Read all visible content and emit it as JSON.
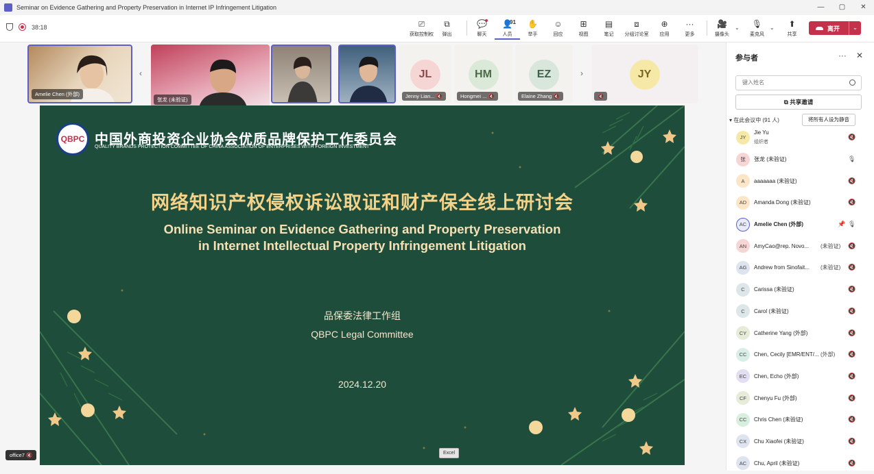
{
  "window": {
    "title": "Seminar on Evidence Gathering and Property Preservation in Internet IP Infringement Litigation",
    "controls": [
      "—",
      "▢",
      "✕"
    ]
  },
  "toolbar": {
    "timer": "38:18",
    "tools": [
      {
        "label": "获取控制权",
        "icon": "take-control-icon"
      },
      {
        "label": "弹出",
        "icon": "pop-out-icon"
      },
      {
        "label": "聊天",
        "icon": "chat-icon"
      },
      {
        "label": "人员",
        "icon": "people-icon",
        "count": "91"
      },
      {
        "label": "举手",
        "icon": "raise-hand-icon"
      },
      {
        "label": "回应",
        "icon": "react-icon"
      },
      {
        "label": "视图",
        "icon": "view-icon"
      },
      {
        "label": "笔记",
        "icon": "notes-icon"
      },
      {
        "label": "分组讨论室",
        "icon": "breakout-rooms-icon"
      },
      {
        "label": "应用",
        "icon": "apps-icon"
      },
      {
        "label": "更多",
        "icon": "more-icon"
      },
      {
        "label": "摄像头",
        "icon": "camera-off-icon"
      },
      {
        "label": "麦克风",
        "icon": "mic-off-icon"
      },
      {
        "label": "共享",
        "icon": "share-icon"
      }
    ],
    "leave_label": "离开"
  },
  "gallery": {
    "tiles": [
      {
        "name": "Amelie Chen (外部)"
      },
      {
        "name": "张龙 (未验证)"
      },
      {
        "name": ""
      },
      {
        "name": ""
      },
      {
        "name": "Jenny Lian...",
        "initials": "JL",
        "color": "#f6d5d5"
      },
      {
        "name": "Hongmei ...",
        "initials": "HM",
        "color": "#dbe9d8"
      },
      {
        "name": "Elaine Zhang",
        "initials": "EZ",
        "color": "#d8e6dc"
      },
      {
        "name": "",
        "initials": "JY",
        "color": "#f6e9a8"
      }
    ]
  },
  "slide": {
    "org_cn": "中国外商投资企业协会优质品牌保护工作委员会",
    "org_en": "QUALITY BRANDS PROTECTION COMMITTEE OF CHINA ASSOCIATION OF ENTERPRISES WITH FOREIGN INVESTMENT",
    "logo_text": "QBPC",
    "title_cn": "网络知识产权侵权诉讼取证和财产保全线上研讨会",
    "title_en_1": "Online Seminar on Evidence Gathering and Property Preservation",
    "title_en_2": "in Internet Intellectual Property Infringement Litigation",
    "group_cn": "品保委法律工作组",
    "group_en": "QBPC Legal Committee",
    "date": "2024.12.20"
  },
  "stage": {
    "excel_tag": "Excel",
    "office_tag": "office7"
  },
  "panel": {
    "title": "参与者",
    "search_placeholder": "键入姓名",
    "share_invite": "共享邀请",
    "in_meeting": "在此会议中 (91 人)",
    "mute_all": "将所有人设为静音",
    "participants": [
      {
        "initials": "JY",
        "name": "Jie Yu",
        "role": "组织者",
        "tag": "",
        "mic": "muted",
        "color": "#f6e9a8"
      },
      {
        "initials": "张",
        "name": "张龙 (未验证)",
        "role": "",
        "tag": "",
        "mic": "on",
        "color": "#f6d5d5"
      },
      {
        "initials": "A",
        "name": "aaaaaaa (未验证)",
        "role": "",
        "tag": "",
        "mic": "muted",
        "color": "#fbe6c8"
      },
      {
        "initials": "AD",
        "name": "Amanda Dong (未验证)",
        "role": "",
        "tag": "",
        "mic": "muted",
        "color": "#fbe6c8"
      },
      {
        "initials": "AC",
        "name": "Amelie Chen (外部)",
        "role": "",
        "tag": "",
        "mic": "on",
        "pin": true,
        "color": "#e8ebfa",
        "bold": true
      },
      {
        "initials": "AN",
        "name": "AmyCao@rep. Novo...",
        "role": "",
        "tag": "(未验证)",
        "mic": "muted",
        "color": "#f6d5d5"
      },
      {
        "initials": "AG",
        "name": "Andrew from Sinofait...",
        "role": "",
        "tag": "(未验证)",
        "mic": "muted",
        "color": "#dde3ef"
      },
      {
        "initials": "C",
        "name": "Carissa (未验证)",
        "role": "",
        "tag": "",
        "mic": "muted",
        "color": "#dde7ea"
      },
      {
        "initials": "C",
        "name": "Carol (未验证)",
        "role": "",
        "tag": "",
        "mic": "muted",
        "color": "#dde7ea"
      },
      {
        "initials": "CY",
        "name": "Catherine Yang (外部)",
        "role": "",
        "tag": "",
        "mic": "muted",
        "color": "#e6ecd8"
      },
      {
        "initials": "CC",
        "name": "Chen, Cecily [EMR/ENT/...",
        "role": "",
        "tag": "(外部)",
        "mic": "muted",
        "color": "#d8efe8"
      },
      {
        "initials": "EC",
        "name": "Chen, Echo (外部)",
        "role": "",
        "tag": "",
        "mic": "muted",
        "color": "#e3def2"
      },
      {
        "initials": "CF",
        "name": "Chenyu Fu (外部)",
        "role": "",
        "tag": "",
        "mic": "muted",
        "color": "#e6ecd8"
      },
      {
        "initials": "CC",
        "name": "Chris Chen (未验证)",
        "role": "",
        "tag": "",
        "mic": "muted",
        "color": "#d8efe0"
      },
      {
        "initials": "CX",
        "name": "Chu Xiaofei (未验证)",
        "role": "",
        "tag": "",
        "mic": "muted",
        "color": "#dde3ef"
      },
      {
        "initials": "AC",
        "name": "Chu, April (未验证)",
        "role": "",
        "tag": "",
        "mic": "muted",
        "color": "#dde3ef"
      }
    ]
  }
}
